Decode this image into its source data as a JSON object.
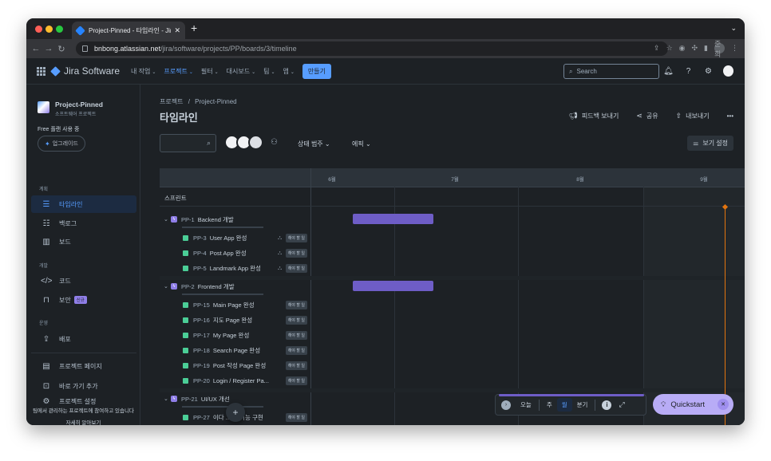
{
  "browser": {
    "tab_title": "Project-Pinned - 타임라인 - Jira",
    "url_host": "bnbong.atlassian.net",
    "url_path": "/jira/software/projects/PP/boards/3/timeline",
    "profile_label": "준희"
  },
  "topnav": {
    "product": "Jira Software",
    "items": [
      "내 작업",
      "프로젝트",
      "필터",
      "대시보드",
      "팀",
      "앱"
    ],
    "create_label": "만들기",
    "search_placeholder": "Search"
  },
  "sidebar": {
    "project_name": "Project-Pinned",
    "project_type": "소프트웨어 프로젝트",
    "free_plan": "Free 플랜 사용 중",
    "upgrade_label": "업그레이드",
    "sections": {
      "planning": "계획",
      "development": "개발",
      "operations": "운영"
    },
    "items": {
      "timeline": "타임라인",
      "backlog": "백로그",
      "board": "보드",
      "code": "코드",
      "security": "보안",
      "security_badge": "신규",
      "deploy": "배포",
      "project_pages": "프로젝트 페이지",
      "add_shortcut": "바로 가기 추가",
      "project_settings": "프로젝트 설정"
    },
    "footer_text": "팀에서 관리하는 프로젝트에 참여하고 있습니다",
    "footer_link": "자세히 알아보기"
  },
  "main": {
    "breadcrumb_root": "프로젝트",
    "breadcrumb_sep": "/",
    "breadcrumb_project": "Project-Pinned",
    "title": "타임라인",
    "actions": {
      "feedback": "피드백 보내기",
      "share": "공유",
      "export": "내보내기",
      "more": "•••"
    },
    "filters": {
      "status_category": "상태 범주",
      "epic": "에픽",
      "view_settings": "보기 설정"
    }
  },
  "timeline": {
    "months": [
      "6월",
      "7월",
      "8월",
      "9월"
    ],
    "sprint_label": "스프린트",
    "epics": [
      {
        "key": "PP-1",
        "name": "Backend 개발",
        "issues": [
          {
            "key": "PP-3",
            "name": "User App 완성",
            "status": "해야 할 일",
            "has_children": true
          },
          {
            "key": "PP-4",
            "name": "Post App 완성",
            "status": "해야 할 일",
            "has_children": true
          },
          {
            "key": "PP-5",
            "name": "Landmark App 완성",
            "status": "해야 할 일",
            "has_children": true
          }
        ]
      },
      {
        "key": "PP-2",
        "name": "Frontend 개발",
        "issues": [
          {
            "key": "PP-15",
            "name": "Main Page 완성",
            "status": "해야 할 일",
            "has_children": false
          },
          {
            "key": "PP-16",
            "name": "지도 Page 완성",
            "status": "해야 할 일",
            "has_children": false
          },
          {
            "key": "PP-17",
            "name": "My Page 완성",
            "status": "해야 할 일",
            "has_children": false
          },
          {
            "key": "PP-18",
            "name": "Search Page 완성",
            "status": "해야 할 일",
            "has_children": false
          },
          {
            "key": "PP-19",
            "name": "Post 작성 Page 완성",
            "status": "해야 할 일",
            "has_children": false
          },
          {
            "key": "PP-20",
            "name": "Login / Register Pa...",
            "status": "해야 할 일",
            "has_children": false
          }
        ]
      },
      {
        "key": "PP-21",
        "name": "UI/UX 개선",
        "issues": [
          {
            "key": "PP-27",
            "name": "이다 ... 드 기능 구현",
            "status": "해야 할 일",
            "has_children": false
          }
        ]
      }
    ]
  },
  "zoom": {
    "today": "오늘",
    "week": "주",
    "month": "월",
    "quarter": "분기"
  },
  "quickstart": {
    "label": "Quickstart"
  },
  "colors": {
    "accent": "#579dff",
    "epic_bar": "#6e5dc6",
    "today_line": "#e2740f",
    "quickstart_bg": "#b8acf6"
  }
}
